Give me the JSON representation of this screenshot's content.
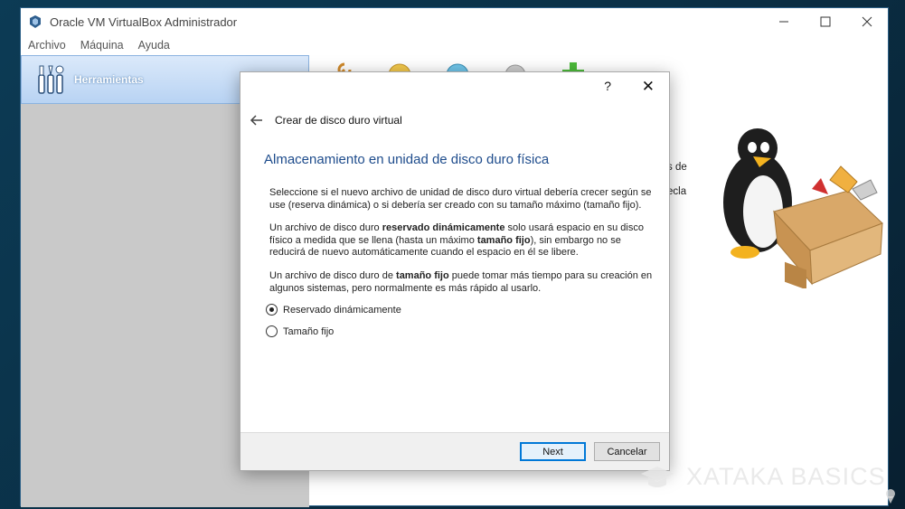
{
  "window": {
    "title": "Oracle VM VirtualBox Administrador",
    "menus": [
      "Archivo",
      "Máquina",
      "Ayuda"
    ]
  },
  "sidebar": {
    "tools_label": "Herramientas"
  },
  "right_panel": {
    "text_1": "s de",
    "text_2": "ecla"
  },
  "dialog": {
    "help": "?",
    "close": "✕",
    "wizard_title": "Crear de disco duro virtual",
    "page_title": "Almacenamiento en unidad de disco duro física",
    "para1": "Seleccione si el nuevo archivo de unidad de disco duro virtual debería crecer según se use (reserva dinámica) o si debería ser creado con su tamaño máximo (tamaño fijo).",
    "para2": {
      "a": "Un archivo de disco duro ",
      "b": "reservado dinámicamente",
      "c": " solo usará espacio en su disco físico a medida que se llena (hasta un máximo ",
      "d": "tamaño fijo",
      "e": "), sin embargo no se reducirá de nuevo automáticamente cuando el espacio en él se libere."
    },
    "para3": {
      "a": "Un archivo de disco duro de ",
      "b": "tamaño fijo",
      "c": " puede tomar más tiempo para su creación en algunos sistemas, pero normalmente es más rápido al usarlo."
    },
    "options": [
      {
        "label": "Reservado dinámicamente",
        "checked": true
      },
      {
        "label": "Tamaño fijo",
        "checked": false
      }
    ],
    "next_label": "Next",
    "cancel_label": "Cancelar"
  },
  "watermark": "XATAKA BASICS"
}
